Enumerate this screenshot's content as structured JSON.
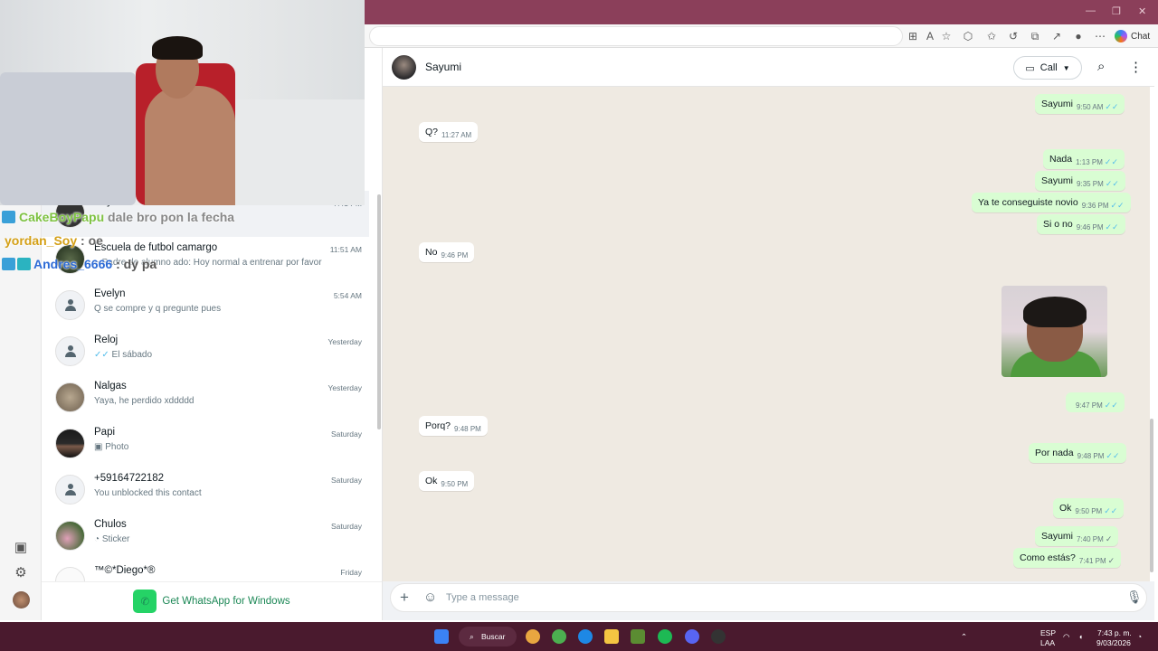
{
  "browser": {
    "chat_label": "Chat"
  },
  "webcam": {
    "overlay_lines": [
      {
        "user": "CakeBoyPapu",
        "text": "dale bro pon la fecha",
        "user_color": "#7ec242"
      },
      {
        "user": "yordan_Soy",
        "text": ": oe",
        "user_color": "#d4a017"
      },
      {
        "user": "Andres_6666",
        "text": ": dy pa",
        "user_color": "#2d6bd6"
      }
    ]
  },
  "sidebar": {
    "icons": [
      "status-icon",
      "settings-icon",
      "profile-avatar"
    ],
    "get_windows_label": "Get WhatsApp for Windows"
  },
  "chats": [
    {
      "name": "Sayumi",
      "preview": "",
      "time": "7:41 PM",
      "avatar": "photo"
    },
    {
      "name": "Escuela de futbol camargo",
      "preview": "~ Padre de alumno ado: Hoy normal a entrenar por favor",
      "time": "11:51 AM",
      "avatar": "photo"
    },
    {
      "name": "Evelyn",
      "preview": "Q se compre y q pregunte pues",
      "time": "5:54 AM",
      "avatar": "default"
    },
    {
      "name": "Reloj",
      "preview": "El sábado",
      "time": "Yesterday",
      "avatar": "default",
      "read": true
    },
    {
      "name": "Nalgas",
      "preview": "Yaya, he perdido xddddd",
      "time": "Yesterday",
      "avatar": "photo"
    },
    {
      "name": "Papi",
      "preview": "Photo",
      "time": "Saturday",
      "avatar": "photo"
    },
    {
      "name": "+59164722182",
      "preview": "You unblocked this contact",
      "time": "Saturday",
      "avatar": "default"
    },
    {
      "name": "Chulos",
      "preview": "Sticker",
      "time": "Saturday",
      "avatar": "photo"
    },
    {
      "name": "™©*Diego*®",
      "preview": "",
      "time": "Friday",
      "avatar": "photo"
    }
  ],
  "conversation": {
    "contact_name": "Sayumi",
    "call_label": "Call",
    "composer_placeholder": "Type a message",
    "messages": [
      {
        "dir": "out",
        "text": "Sayumi",
        "time": "9:50 AM",
        "status": "read"
      },
      {
        "dir": "in",
        "text": "Q?",
        "time": "11:27 AM"
      },
      {
        "dir": "out",
        "text": "Nada",
        "time": "1:13 PM",
        "status": "read"
      },
      {
        "dir": "out",
        "text": "Sayumi",
        "time": "9:35 PM",
        "status": "read"
      },
      {
        "dir": "out",
        "text": "Ya te conseguiste novio",
        "time": "9:36 PM",
        "status": "read"
      },
      {
        "dir": "out",
        "text": "Si o no",
        "time": "9:46 PM",
        "status": "read"
      },
      {
        "dir": "in",
        "text": "No",
        "time": "9:46 PM"
      },
      {
        "dir": "out",
        "text": "",
        "time": "9:47 PM",
        "status": "read",
        "type": "image"
      },
      {
        "dir": "in",
        "text": "Porq?",
        "time": "9:48 PM"
      },
      {
        "dir": "out",
        "text": "Por nada",
        "time": "9:48 PM",
        "status": "read"
      },
      {
        "dir": "in",
        "text": "Ok",
        "time": "9:50 PM"
      },
      {
        "dir": "out",
        "text": "Ok",
        "time": "9:50 PM",
        "status": "read"
      },
      {
        "dir": "out",
        "text": "Sayumi",
        "time": "7:40 PM",
        "status": "sent"
      },
      {
        "dir": "out",
        "text": "Como estás?",
        "time": "7:41 PM",
        "status": "sent"
      }
    ]
  },
  "taskbar": {
    "search_label": "Buscar",
    "lang_top": "ESP",
    "lang_bottom": "LAA",
    "time": "7:43 p. m.",
    "date": "9/03/2026"
  }
}
